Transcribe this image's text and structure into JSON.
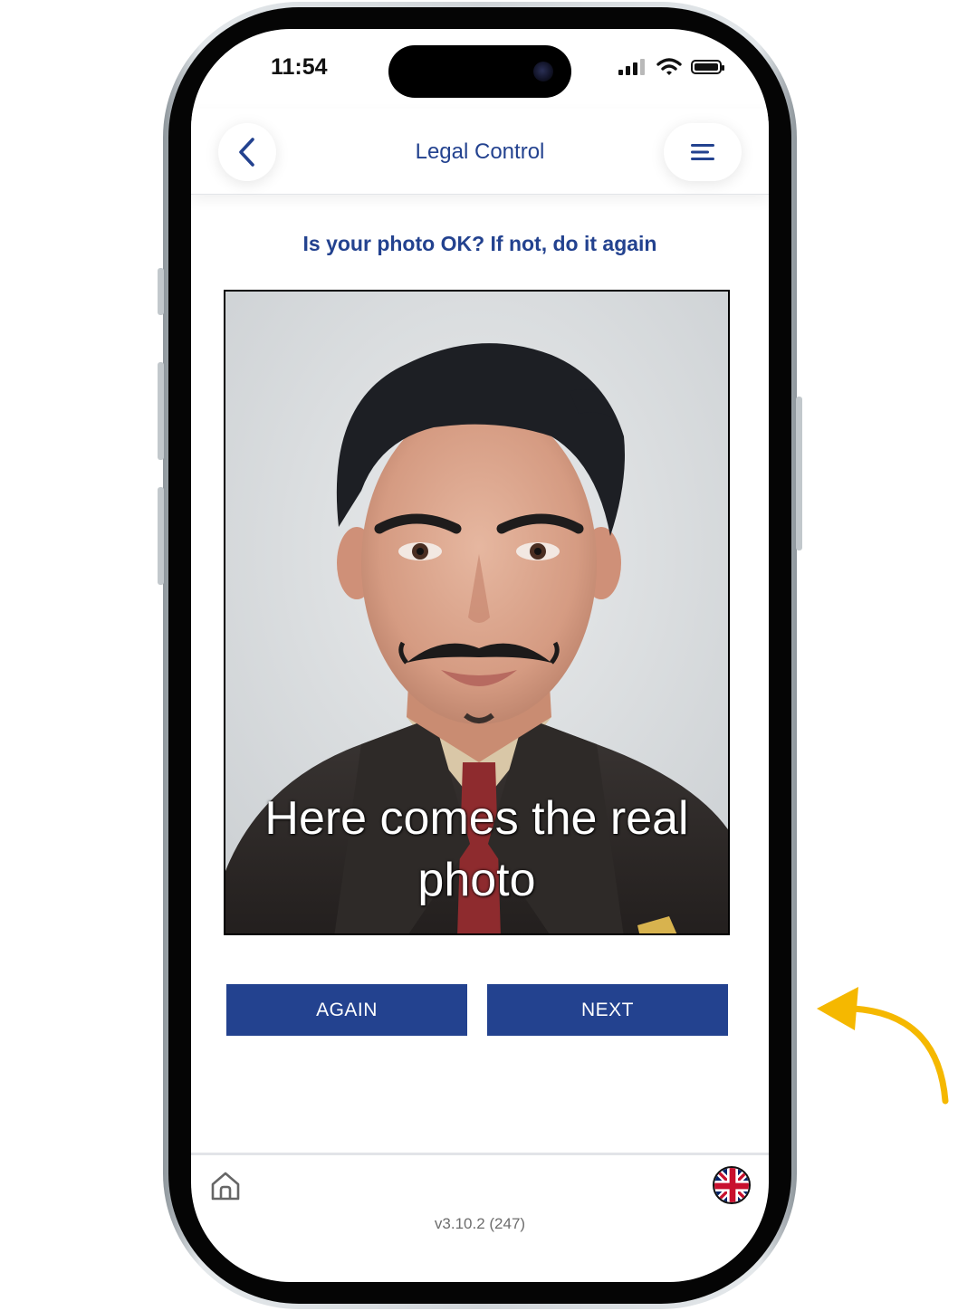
{
  "status_bar": {
    "time": "11:54"
  },
  "header": {
    "title": "Legal Control",
    "back_icon": "chevron-left-icon",
    "menu_icon": "menu-icon"
  },
  "prompt": "Is your photo OK? If not, do it again",
  "photo": {
    "overlay_text": "Here comes the real photo"
  },
  "actions": {
    "again_label": "AGAIN",
    "next_label": "NEXT"
  },
  "footer": {
    "home_icon": "home-icon",
    "language_icon": "uk-flag-icon",
    "version": "v3.10.2 (247)"
  },
  "colors": {
    "brand_blue": "#23428f",
    "arrow_yellow": "#f5b800"
  }
}
